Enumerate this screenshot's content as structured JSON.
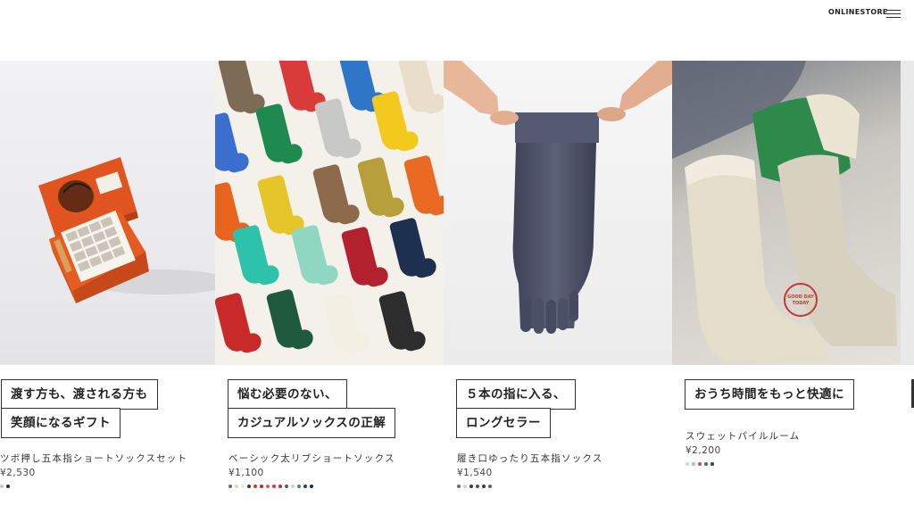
{
  "header": {
    "store_label": "ONLINESTORE",
    "menu_icon": "hamburger-menu-icon"
  },
  "products": [
    {
      "caption": [
        "渡す方も、渡される方も",
        "笑顔になるギフト"
      ],
      "name": "ツボ押し五本指ショートソックスセット",
      "price": "¥2,530",
      "swatches": [
        "#c9c9c9",
        "#2b2b2b"
      ]
    },
    {
      "caption": [
        "悩む必要のない、",
        "カジュアルソックスの正解"
      ],
      "name": "ベーシック太リブショートソックス",
      "price": "¥1,100",
      "swatches": [
        "#7a6a55",
        "#d9d6cf",
        "#ece9e3",
        "#3a3a3a",
        "#b5472a",
        "#c3272b",
        "#e0603a",
        "#c63b55",
        "#b03049",
        "#3c6e4e",
        "#d8d2c3",
        "#5a7a9a",
        "#2c3e6b",
        "#1f2a44"
      ]
    },
    {
      "caption": [
        "５本の指に入る、",
        "ロングセラー"
      ],
      "name": "履き口ゆったり五本指ソックス",
      "price": "¥1,540",
      "swatches": [
        "#6b6b6b",
        "#cfcfcf",
        "#3a3a3a",
        "#4a4f6a",
        "#2f3a55",
        "#5b6075"
      ]
    },
    {
      "caption": [
        "おうち時間をもっと快適に"
      ],
      "name": "スウェットパイルルーム",
      "price": "¥2,200",
      "swatches": [
        "#d9d4c8",
        "#b5b5b5",
        "#c94d3c",
        "#3d7a4b",
        "#2f3d5a"
      ]
    }
  ]
}
